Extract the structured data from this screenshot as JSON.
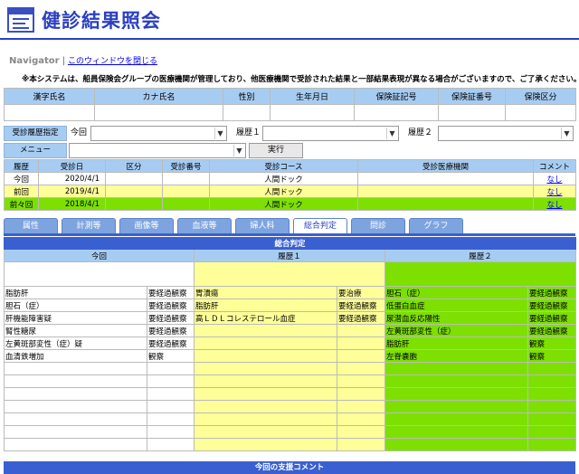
{
  "app": {
    "title": "健診結果照会"
  },
  "navigator": {
    "label": "Navigator",
    "separator": "|",
    "close_link": "このウィンドウを閉じる"
  },
  "notice": "※本システムは、船員保険会グループの医療機関が管理しており、他医療機関で受診された結果と一部結果表現が異なる場合がございますので、ご了承ください。",
  "patient": {
    "headers": [
      "漢字氏名",
      "カナ氏名",
      "性別",
      "生年月日",
      "保険証記号",
      "保険証番号",
      "保険区分"
    ],
    "values": [
      "",
      "",
      "",
      "",
      "",
      "",
      ""
    ]
  },
  "filters": {
    "history_label": "受診履歴指定",
    "current_label": "今回",
    "rireki1_label": "履歴１",
    "rireki2_label": "履歴２",
    "menu_label": "メニュー",
    "current_value": "",
    "rireki1_value": "",
    "rireki2_value": "",
    "menu_value": "",
    "execute_label": "実行",
    "dropdown_icon": "▼"
  },
  "history": {
    "headers": [
      "履歴",
      "受診日",
      "区分",
      "受診番号",
      "受診コース",
      "受診医療機関",
      "コメント"
    ],
    "rows": [
      {
        "label": "今回",
        "date": "2020/4/1",
        "kubun": "",
        "number": "",
        "course": "人間ドック",
        "facility": "",
        "comment": "なし"
      },
      {
        "label": "前回",
        "date": "2019/4/1",
        "kubun": "",
        "number": "",
        "course": "人間ドック",
        "facility": "",
        "comment": "なし"
      },
      {
        "label": "前々回",
        "date": "2018/4/1",
        "kubun": "",
        "number": "",
        "course": "人間ドック",
        "facility": "",
        "comment": "なし"
      }
    ]
  },
  "tabs": [
    "属性",
    "計測等",
    "画像等",
    "血液等",
    "婦人科",
    "総合判定",
    "問診",
    "グラフ"
  ],
  "active_tab": "総合判定",
  "result": {
    "title": "総合判定",
    "columns": [
      "今回",
      "履歴１",
      "履歴２"
    ],
    "rows": [
      {
        "c1": "脂肪肝",
        "j1": "要経過観察",
        "c2": "胃潰瘍",
        "j2": "要治療",
        "c3": "胆石（症）",
        "j3": "要経過観察"
      },
      {
        "c1": "胆石（症）",
        "j1": "要経過観察",
        "c2": "脂肪肝",
        "j2": "要経過観察",
        "c3": "低蛋白血症",
        "j3": "要経過観察"
      },
      {
        "c1": "肝機能障害疑",
        "j1": "要経過観察",
        "c2": "高ＬＤＬコレステロール血症",
        "j2": "要経過観察",
        "c3": "尿潜血反応陽性",
        "j3": "要経過観察"
      },
      {
        "c1": "腎性糖尿",
        "j1": "要経過観察",
        "c2": "",
        "j2": "",
        "c3": "左黄斑部変性（症）",
        "j3": "要経過観察"
      },
      {
        "c1": "左黄斑部変性（症）疑",
        "j1": "要経過観察",
        "c2": "",
        "j2": "",
        "c3": "脂肪肝",
        "j3": "観察"
      },
      {
        "c1": "血清鉄増加",
        "j1": "観察",
        "c2": "",
        "j2": "",
        "c3": "左脊嚢胞",
        "j3": "観察"
      },
      {
        "c1": "",
        "j1": "",
        "c2": "",
        "j2": "",
        "c3": "",
        "j3": ""
      },
      {
        "c1": "",
        "j1": "",
        "c2": "",
        "j2": "",
        "c3": "",
        "j3": ""
      },
      {
        "c1": "",
        "j1": "",
        "c2": "",
        "j2": "",
        "c3": "",
        "j3": ""
      },
      {
        "c1": "",
        "j1": "",
        "c2": "",
        "j2": "",
        "c3": "",
        "j3": ""
      },
      {
        "c1": "",
        "j1": "",
        "c2": "",
        "j2": "",
        "c3": "",
        "j3": ""
      },
      {
        "c1": "",
        "j1": "",
        "c2": "",
        "j2": "",
        "c3": "",
        "j3": ""
      },
      {
        "c1": "",
        "j1": "",
        "c2": "",
        "j2": "",
        "c3": "",
        "j3": ""
      }
    ]
  },
  "support_title": "今回の支援コメント",
  "colors": {
    "accent": "#2b3fc1",
    "header_bg": "#a7ccf2",
    "prev": "#ffff99",
    "prev2": "#7de000"
  }
}
